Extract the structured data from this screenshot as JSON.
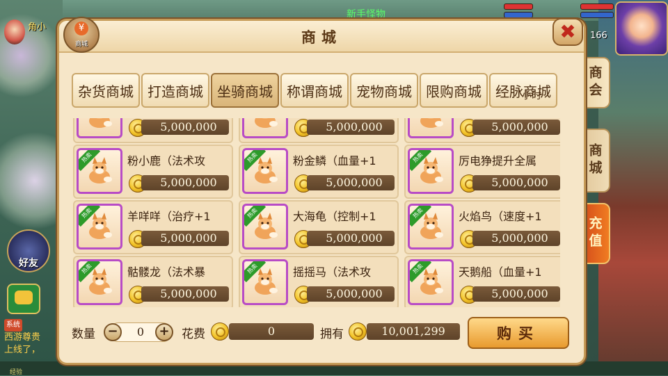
{
  "hud": {
    "left_name": "角小",
    "quest_text": "新手怪物",
    "level": "166",
    "friend_label": "好友",
    "chat": {
      "sys_tag": "系统",
      "line1": "西游尊贵",
      "line2": "上线了，",
      "exp_label": "经验"
    }
  },
  "side_tabs": [
    "商会",
    "商城",
    "充值"
  ],
  "panel": {
    "title": "商城",
    "emblem_label": "商城",
    "emblem_symbol": "¥",
    "close_symbol": "✖"
  },
  "tabs": [
    {
      "label": "杂货商城",
      "active": false
    },
    {
      "label": "打造商城",
      "active": false
    },
    {
      "label": "坐骑商城",
      "active": true
    },
    {
      "label": "称谓商城",
      "active": false
    },
    {
      "label": "宠物商城",
      "active": false
    },
    {
      "label": "限购商城",
      "active": false
    },
    {
      "label": "经脉商城",
      "active": false
    }
  ],
  "tab_overlap_text": "小时",
  "hot_badge": "热卖",
  "items": [
    {
      "name": "",
      "price": "5,000,000"
    },
    {
      "name": "",
      "price": "5,000,000"
    },
    {
      "name": "",
      "price": "5,000,000"
    },
    {
      "name": "粉小鹿（法术攻",
      "price": "5,000,000"
    },
    {
      "name": "粉金鳞（血量+1",
      "price": "5,000,000"
    },
    {
      "name": "厉电狰提升全属",
      "price": "5,000,000"
    },
    {
      "name": "羊咩咩（治疗+1",
      "price": "5,000,000"
    },
    {
      "name": "大海龟（控制+1",
      "price": "5,000,000"
    },
    {
      "name": "火焰鸟（速度+1",
      "price": "5,000,000"
    },
    {
      "name": "骷髅龙（法术暴",
      "price": "5,000,000"
    },
    {
      "name": "摇摇马（法术攻",
      "price": "5,000,000"
    },
    {
      "name": "天鹅船（血量+1",
      "price": "5,000,000"
    }
  ],
  "footer": {
    "qty_label": "数量",
    "qty_value": "0",
    "minus": "−",
    "plus": "+",
    "cost_label": "花费",
    "cost_value": "0",
    "own_label": "拥有",
    "own_value": "10,001,299",
    "buy_label": "购买"
  },
  "colors": {
    "accent": "#e89a2e",
    "purple_frame": "#b84bc6",
    "hot_green": "#2d9b2a",
    "close_red": "#c0281c"
  }
}
